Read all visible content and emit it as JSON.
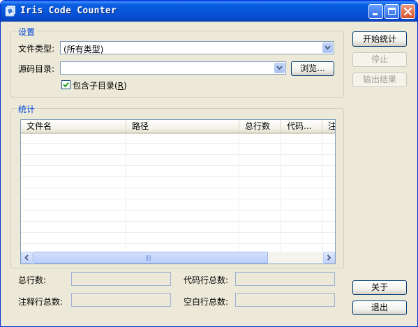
{
  "window": {
    "title": "Iris Code Counter"
  },
  "settings": {
    "legend": "设置",
    "file_type_label": "文件类型:",
    "file_type_value": "(所有类型)",
    "source_dir_label": "源码目录:",
    "source_dir_value": "",
    "browse_label": "浏览...",
    "include_subdirs_label": "包含子目录(",
    "include_subdirs_hotkey": "R",
    "include_subdirs_suffix": ")",
    "include_subdirs_checked": true
  },
  "stats": {
    "legend": "统计",
    "columns": [
      "文件名",
      "路径",
      "总行数",
      "代码...",
      "注"
    ],
    "rows": []
  },
  "summary": {
    "total_lines_label": "总行数:",
    "code_lines_label": "代码行总数:",
    "comment_lines_label": "注释行总数:",
    "blank_lines_label": "空白行总数:",
    "total_lines": "",
    "code_lines": "",
    "comment_lines": "",
    "blank_lines": ""
  },
  "actions": {
    "start_label": "开始统计",
    "stop_label": "停止",
    "export_label": "输出结果",
    "about_label": "关于",
    "exit_label": "退出"
  }
}
